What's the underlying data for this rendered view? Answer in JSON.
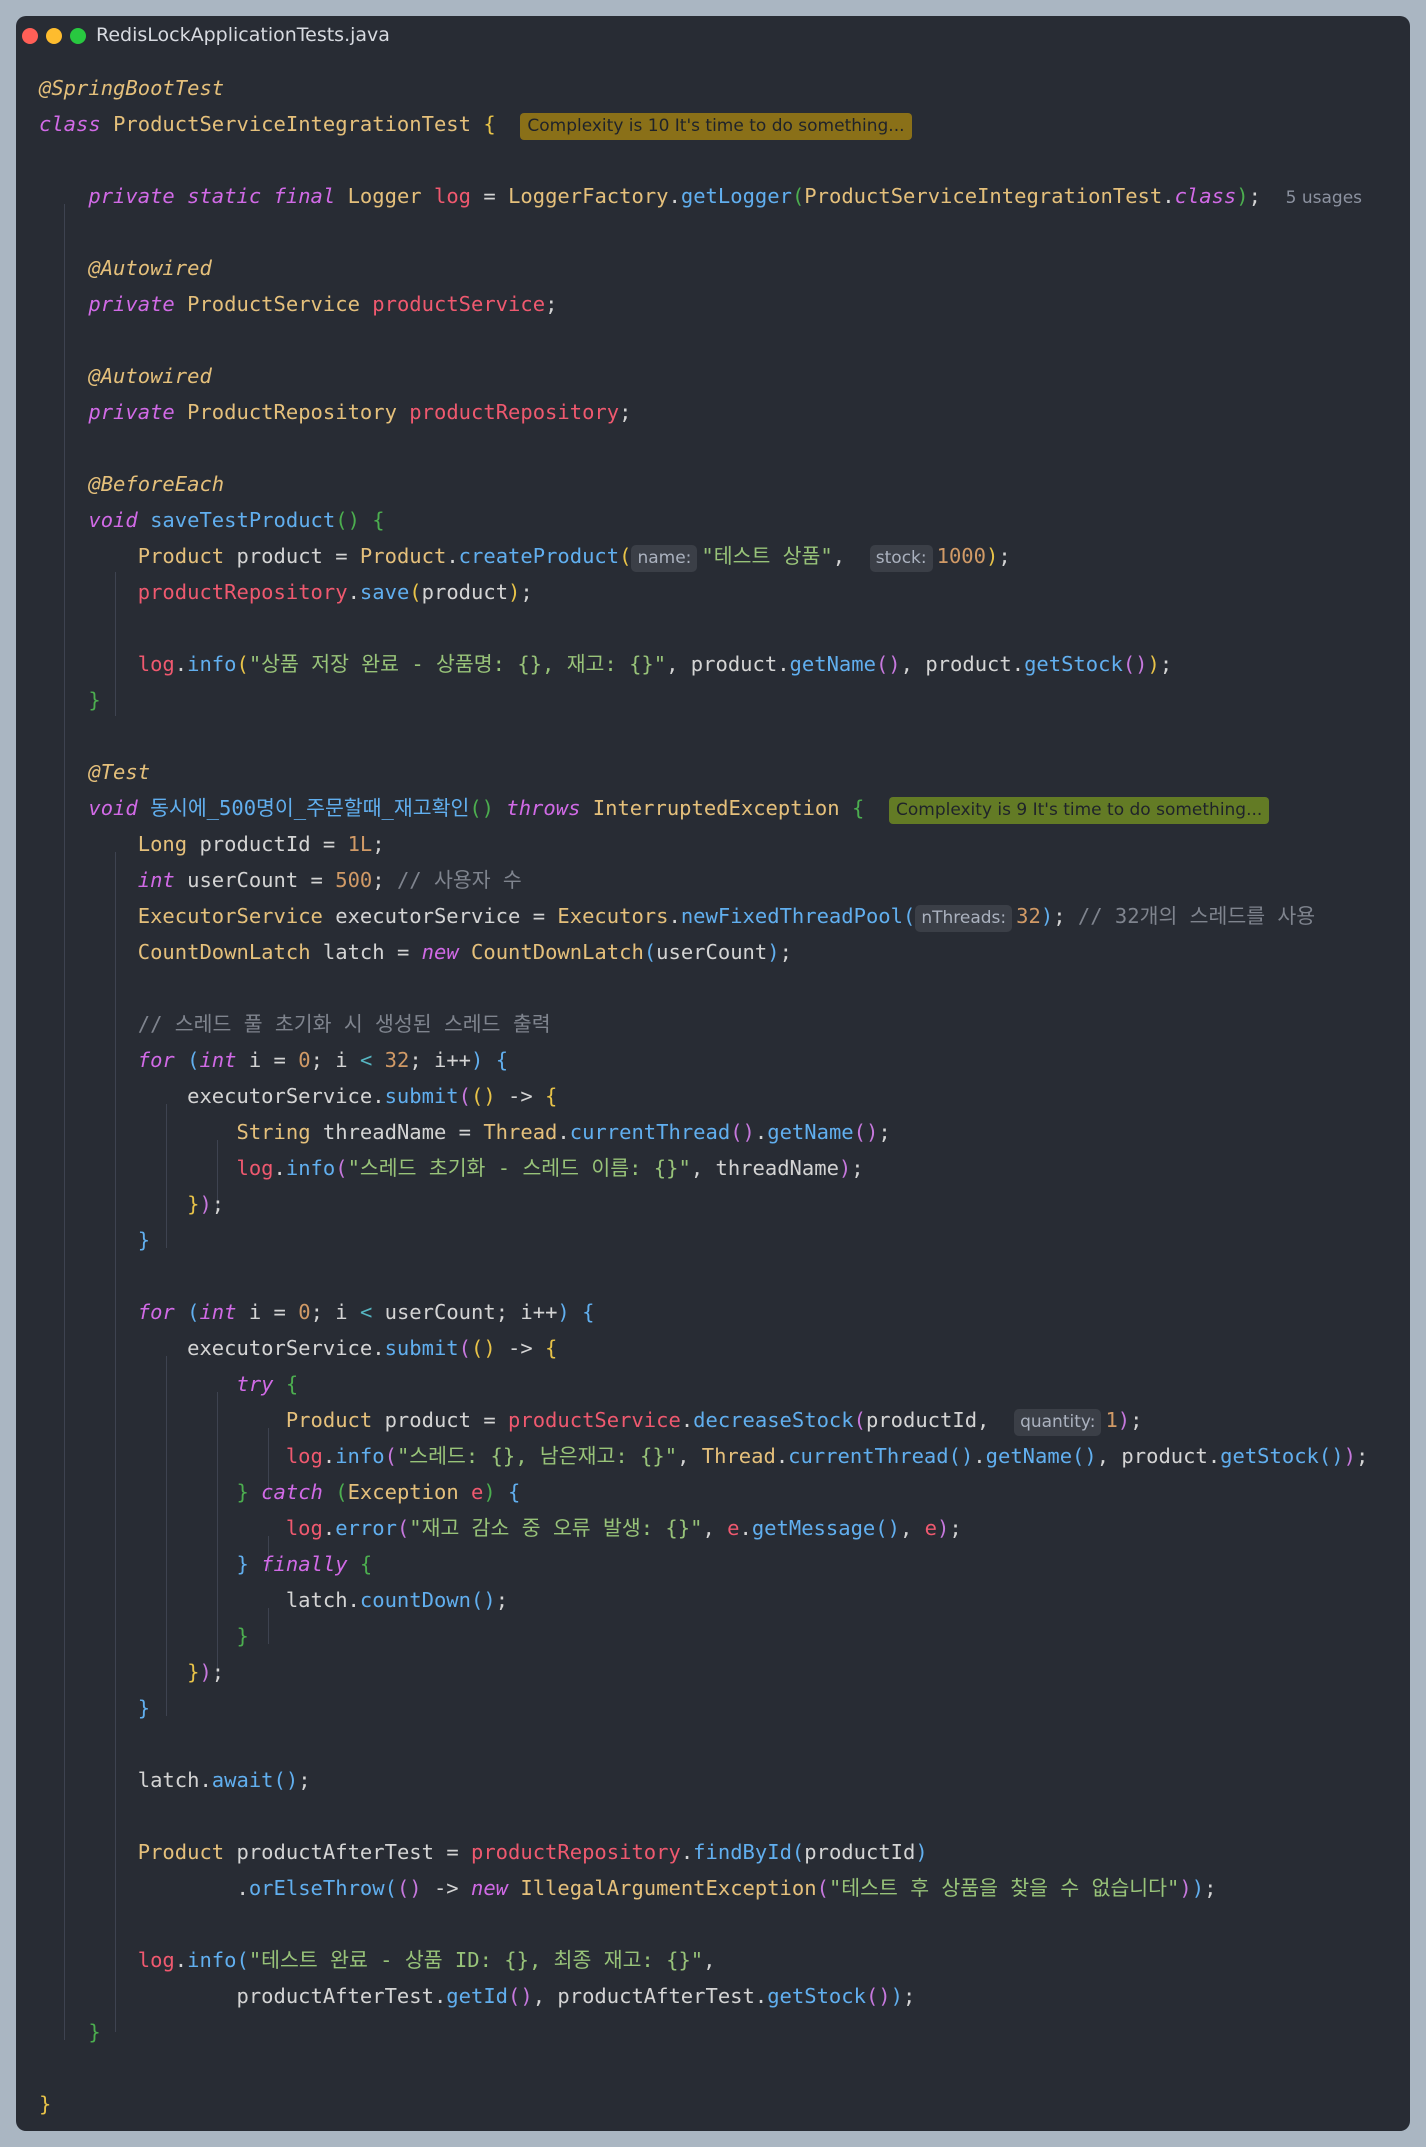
{
  "window": {
    "title": "RedisLockApplicationTests.java"
  },
  "inlays": {
    "complexity_class": "Complexity is 10 It's time to do something...",
    "complexity_test": "Complexity is 9 It's time to do something...",
    "usages": "5 usages",
    "hint_name": "name:",
    "hint_stock": "stock:",
    "hint_nthreads": "nThreads:",
    "hint_quantity": "quantity:"
  },
  "code": {
    "annotation_springboottest": "@SpringBootTest",
    "class_name": "ProductServiceIntegrationTest",
    "annotation_autowired": "@Autowired",
    "annotation_beforeeach": "@BeforeEach",
    "annotation_test": "@Test",
    "method_save": "saveTestProduct",
    "method_test": "동시에_500명이_주문할때_재고확인",
    "str_product_name": "\"테스트 상품\"",
    "str_save_log": "\"상품 저장 완료 - 상품명: {}, 재고: {}\"",
    "cmt_user": "// 사용자 수",
    "cmt_threads": "// 32개의 스레드를 사용",
    "cmt_pool": "// 스레드 풀 초기화 시 생성된 스레드 출력",
    "str_thread_init": "\"스레드 초기화 - 스레드 이름: {}\"",
    "str_stock_left": "\"스레드: {}, 남은재고: {}\"",
    "str_error": "\"재고 감소 중 오류 발생: {}\"",
    "str_not_found": "\"테스트 후 상품을 찾을 수 없습니다\"",
    "str_done": "\"테스트 완료 - 상품 ID: {}, 최종 재고: {}\""
  }
}
